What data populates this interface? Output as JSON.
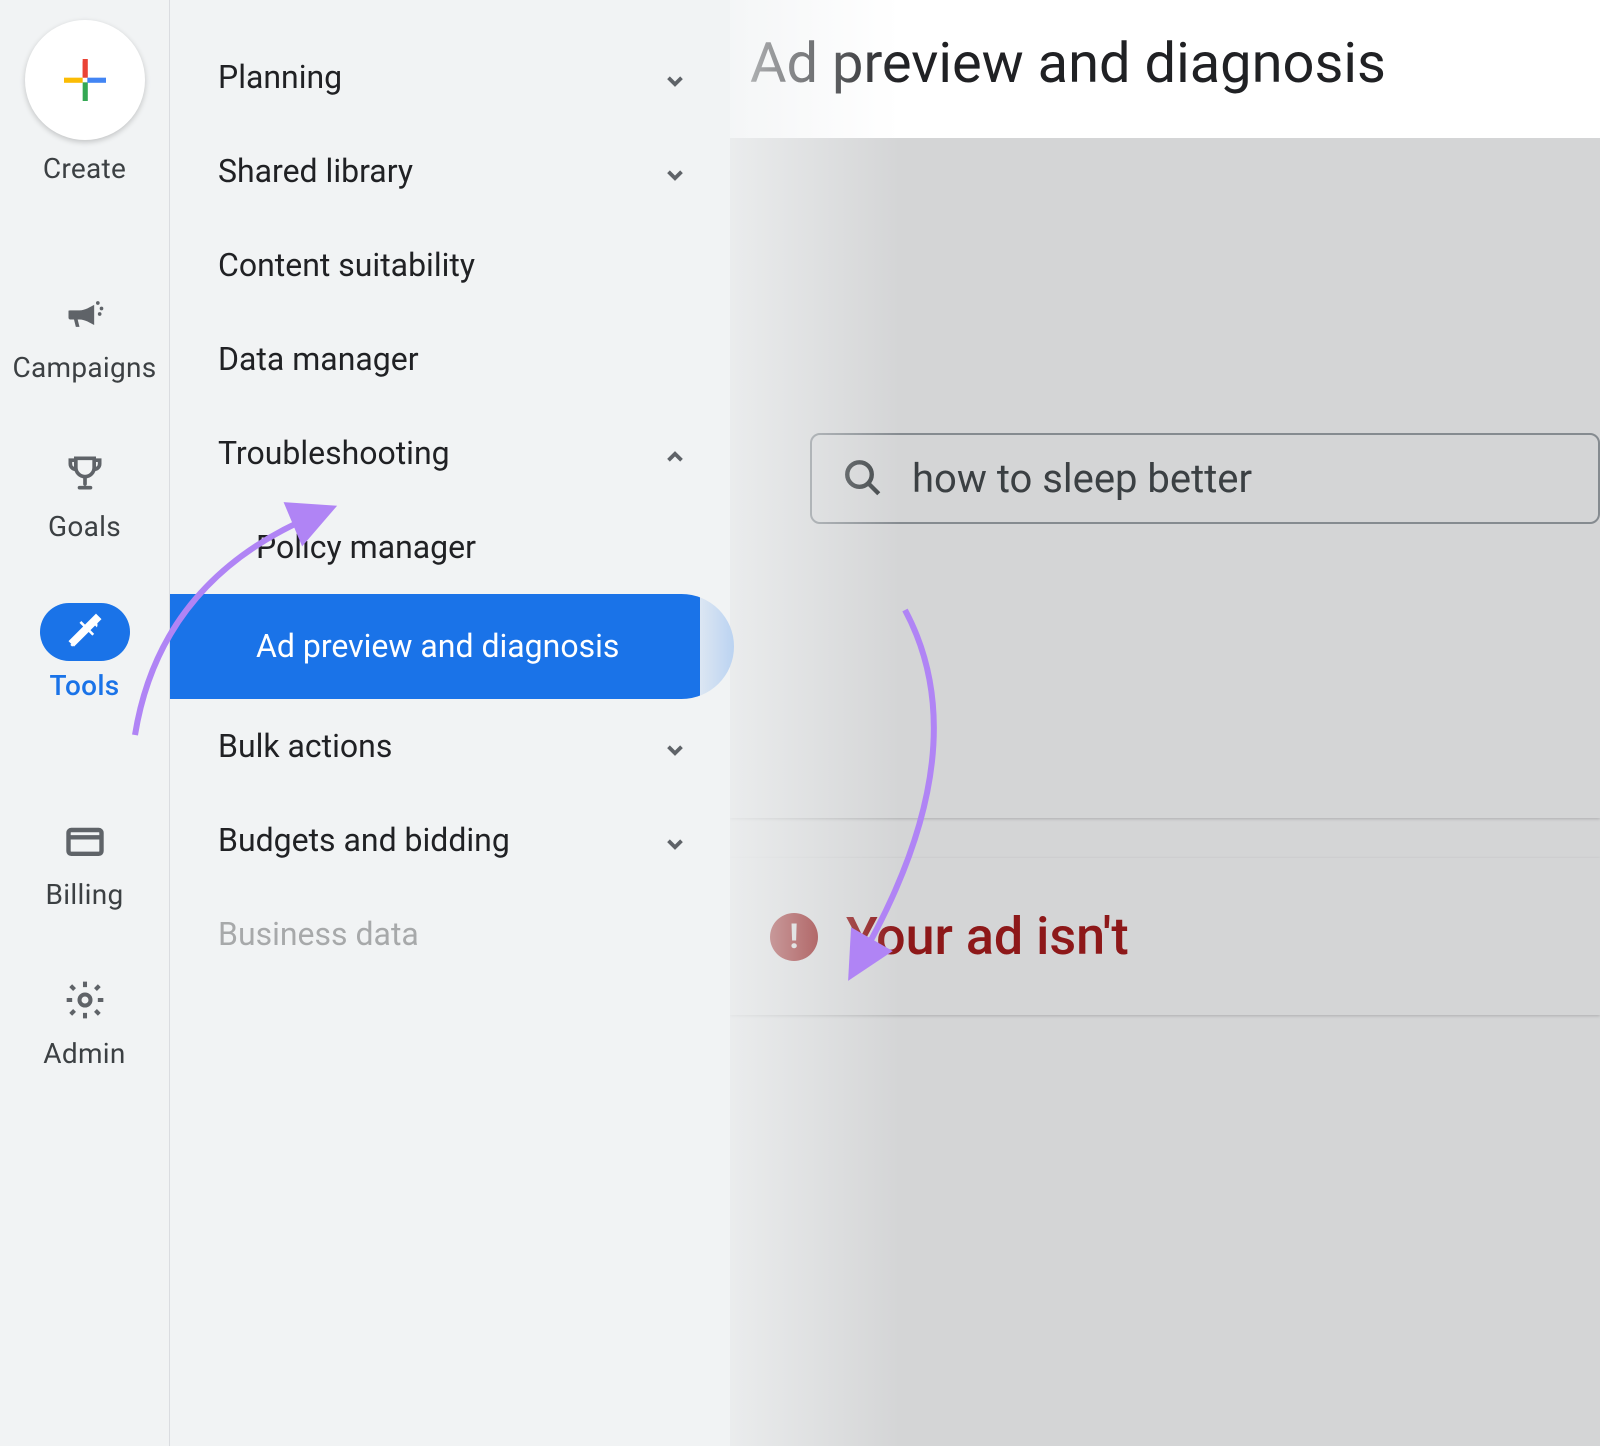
{
  "rail": {
    "create": "Create",
    "campaigns": "Campaigns",
    "goals": "Goals",
    "tools": "Tools",
    "billing": "Billing",
    "admin": "Admin"
  },
  "submenu": {
    "planning": "Planning",
    "shared_library": "Shared library",
    "content_suitability": "Content suitability",
    "data_manager": "Data manager",
    "troubleshooting": "Troubleshooting",
    "policy_manager": "Policy manager",
    "ad_preview": "Ad preview and diagnosis",
    "bulk_actions": "Bulk actions",
    "budgets_bidding": "Budgets and bidding",
    "business_data": "Business data"
  },
  "main": {
    "title": "Ad preview and diagnosis",
    "search_query": "how to sleep better",
    "alert_text": "Your ad isn't"
  }
}
